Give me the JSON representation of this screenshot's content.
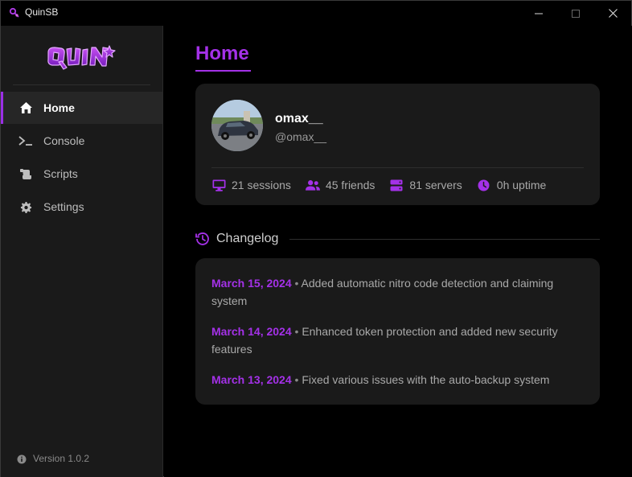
{
  "window": {
    "title": "QuinSB",
    "controls": [
      "minimize",
      "maximize",
      "close"
    ]
  },
  "sidebar": {
    "logo_text": "QUIN",
    "items": [
      {
        "label": "Home",
        "icon": "home-icon",
        "active": true
      },
      {
        "label": "Console",
        "icon": "terminal-icon",
        "active": false
      },
      {
        "label": "Scripts",
        "icon": "scroll-icon",
        "active": false
      },
      {
        "label": "Settings",
        "icon": "gear-icon",
        "active": false
      }
    ],
    "version": "Version 1.0.2"
  },
  "main": {
    "title": "Home",
    "profile": {
      "username": "omax__",
      "handle": "@omax__",
      "stats": [
        {
          "icon": "monitor-icon",
          "text": "21 sessions"
        },
        {
          "icon": "users-icon",
          "text": "45 friends"
        },
        {
          "icon": "server-icon",
          "text": "81 servers"
        },
        {
          "icon": "clock-icon",
          "text": "0h uptime"
        }
      ]
    },
    "changelog": {
      "title": "Changelog",
      "entries": [
        {
          "date": "March 15, 2024",
          "separator": "•",
          "text": "Added automatic nitro code detection and claiming system"
        },
        {
          "date": "March 14, 2024",
          "separator": "•",
          "text": "Enhanced token protection and added new security features"
        },
        {
          "date": "March 13, 2024",
          "separator": "•",
          "text": "Fixed various issues with the auto-backup system"
        }
      ]
    }
  },
  "colors": {
    "accent": "#a431e8",
    "sidebar_bg": "#1a1a1a",
    "card_bg": "#1a1a1a",
    "background": "#000000"
  }
}
